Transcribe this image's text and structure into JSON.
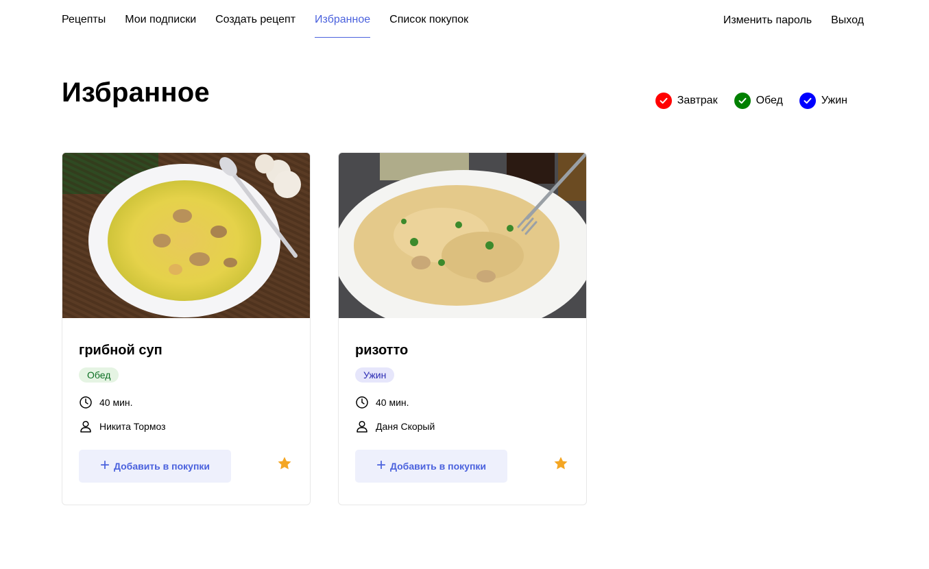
{
  "nav": {
    "left": [
      "Рецепты",
      "Мои подписки",
      "Создать рецепт",
      "Избранное",
      "Список покупок"
    ],
    "active_index": 3,
    "right": [
      "Изменить пароль",
      "Выход"
    ]
  },
  "page": {
    "title": "Избранное"
  },
  "filters": [
    {
      "label": "Завтрак",
      "color": "#ff0000"
    },
    {
      "label": "Обед",
      "color": "#008000"
    },
    {
      "label": "Ужин",
      "color": "#0000ff"
    }
  ],
  "cards": [
    {
      "title": "грибной суп",
      "tag": "Обед",
      "tag_bg": "#e5f4e3",
      "tag_color": "#0b6e22",
      "time": "40 мин.",
      "author": "Никита Тормоз",
      "add_label": "Добавить в покупки",
      "favorite": true
    },
    {
      "title": "ризотто",
      "tag": "Ужин",
      "tag_bg": "#e6e6fb",
      "tag_color": "#2b2bb3",
      "time": "40 мин.",
      "author": "Даня Скорый",
      "add_label": "Добавить в покупки",
      "favorite": true
    }
  ],
  "colors": {
    "accent": "#4a61dd",
    "star": "#f4a623"
  }
}
